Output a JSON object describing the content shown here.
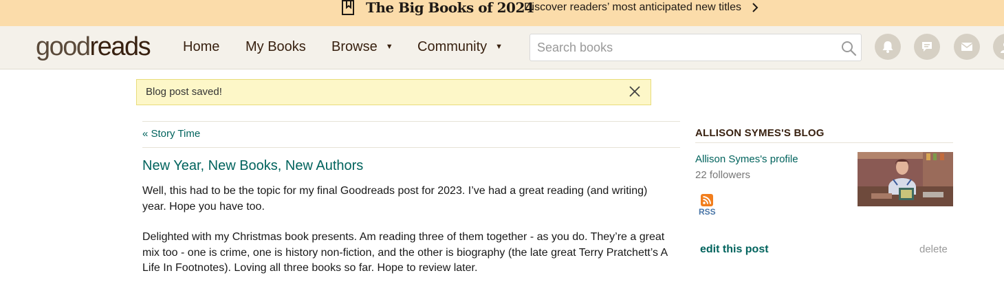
{
  "promo": {
    "title": "The Big Books of 2024",
    "subtitle": "Discover readers’ most anticipated new titles",
    "icon": "bookmark-book-icon",
    "background": "#fbdcaa"
  },
  "header": {
    "logo_thin": "good",
    "logo_bold": "reads",
    "nav": {
      "home": "Home",
      "my_books": "My Books",
      "browse": "Browse",
      "community": "Community"
    },
    "search": {
      "placeholder": "Search books",
      "value": ""
    },
    "icons": [
      "bell-icon",
      "friend-requests-icon",
      "mail-icon",
      "profile-avatar"
    ]
  },
  "flash": {
    "message": "Blog post saved!"
  },
  "post": {
    "back_link": "« Story Time",
    "title": "New Year, New Books, New Authors",
    "paragraphs": [
      "Well, this had to be the topic for my final Goodreads post for 2023. I’ve had a great reading (and writing) year. Hope you have too.",
      "Delighted with my Christmas book presents. Am reading three of them together - as you do. They’re a great mix too - one is crime, one is history non-fiction, and the other is biography (the late great Terry Pratchett’s A Life In Footnotes). Loving all three books so far. Hope to review later."
    ]
  },
  "sidebar": {
    "title": "ALLISON SYMES'S BLOG",
    "profile_link": "Allison Symes's profile",
    "followers": "22 followers",
    "rss_label": "RSS",
    "edit_link": "edit this post",
    "delete_link": "delete"
  },
  "colors": {
    "link": "#00635d",
    "header_bg": "#f4f1ea",
    "flash_bg": "#fdf7c8"
  }
}
